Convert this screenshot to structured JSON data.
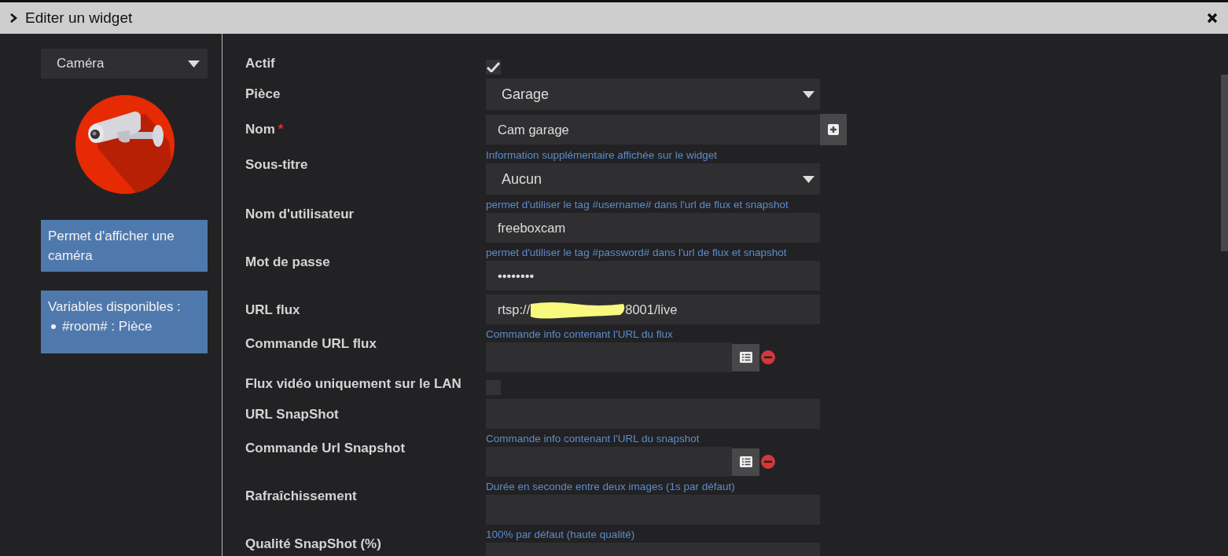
{
  "window": {
    "title": "Editer un widget"
  },
  "sidebar": {
    "widget_type": "Caméra",
    "description": "Permet d'afficher une caméra",
    "variables_title": "Variables disponibles :",
    "variables": [
      "#room# : Pièce"
    ]
  },
  "form": [
    {
      "label": "Actif",
      "kind": "checkbox",
      "checked": true
    },
    {
      "label": "Pièce",
      "kind": "select",
      "value": "Garage"
    },
    {
      "label": "Nom",
      "required_mark": "*",
      "kind": "text",
      "value": "Cam garage",
      "add_button": true
    },
    {
      "label": "Sous-titre",
      "kind": "select",
      "help": "Information supplémentaire affichée sur le widget",
      "value": "Aucun"
    },
    {
      "label": "Nom d'utilisateur",
      "kind": "text",
      "help": "permet d'utiliser le tag #username# dans l'url de flux et snapshot",
      "value": "freeboxcam"
    },
    {
      "label": "Mot de passe",
      "kind": "text",
      "help": "permet d'utiliser le tag #password# dans l'url de flux et snapshot",
      "value": "••••••••"
    },
    {
      "label": "URL flux",
      "kind": "redacted",
      "value_start": "rtsp://",
      "value_end": "8001/live"
    },
    {
      "label": "Commande URL flux",
      "kind": "command",
      "help": "Commande info contenant l'URL du flux"
    },
    {
      "label": "Flux vidéo uniquement sur le LAN",
      "kind": "checkbox",
      "checked": false
    },
    {
      "label": "URL SnapShot",
      "kind": "text"
    },
    {
      "label": "Commande Url Snapshot",
      "kind": "command",
      "help": "Commande info contenant l'URL du snapshot"
    },
    {
      "label": "Rafraîchissement",
      "kind": "text",
      "help": "Durée en seconde entre deux images (1s par défaut)"
    },
    {
      "label": "Qualité SnapShot (%)",
      "kind": "text",
      "help": "100% par défaut (haute qualité)"
    }
  ]
}
